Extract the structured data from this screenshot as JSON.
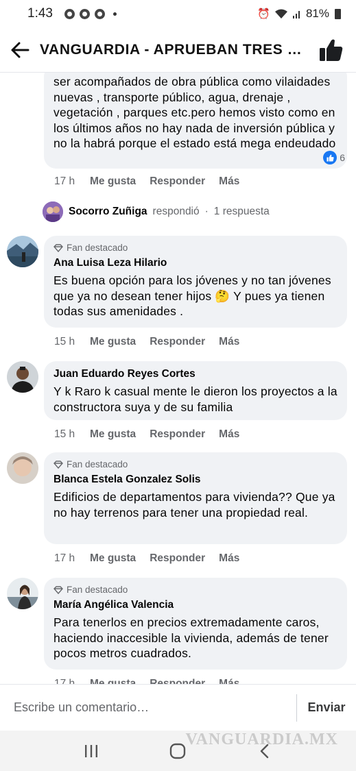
{
  "status_bar": {
    "time": "1:43",
    "battery": "81%"
  },
  "header": {
    "title": "VANGUARDIA - APRUEBAN TRES DE..."
  },
  "comments": [
    {
      "text": "ser acompañados de obra pública como vilaidades nuevas , transporte público, agua, drenaje , vegetación , parques etc.pero hemos visto como en los últimos años no hay nada de inversión pública y no la habrá porque el estado está mega endeudado",
      "reaction_count": "6",
      "time": "17 h",
      "like": "Me gusta",
      "reply": "Responder",
      "more": "Más"
    },
    {
      "badge": "Fan destacado",
      "author": "Ana Luisa Leza Hilario",
      "text": "Es buena opción para los jóvenes y no tan jóvenes que ya no desean tener hijos 🤔 Y pues ya tienen todas sus amenidades .",
      "time": "15 h",
      "like": "Me gusta",
      "reply": "Responder",
      "more": "Más"
    },
    {
      "author": "Juan Eduardo Reyes Cortes",
      "text": "Y k Raro k casual mente le dieron los proyectos a la constructora suya y de su familia",
      "time": "15 h",
      "like": "Me gusta",
      "reply": "Responder",
      "more": "Más"
    },
    {
      "badge": "Fan destacado",
      "author": "Blanca Estela Gonzalez Solis",
      "text": "Edificios de departamentos para vivienda?? Que ya no hay terrenos para tener una propiedad real.",
      "time": "17 h",
      "like": "Me gusta",
      "reply": "Responder",
      "more": "Más"
    },
    {
      "badge": "Fan destacado",
      "author": "María Angélica Valencia",
      "text": "Para tenerlos en precios extremadamente caros, haciendo inaccesible la vivienda, además de tener pocos metros cuadrados.",
      "time": "17 h",
      "like": "Me gusta",
      "reply": "Responder",
      "more": "Más"
    }
  ],
  "reply_summary": {
    "author": "Socorro Zuñiga",
    "verb": "respondió",
    "separator": "·",
    "count": "1 respuesta"
  },
  "composer": {
    "placeholder": "Escribe un comentario…",
    "send_label": "Enviar"
  },
  "watermark": "VANGUARDIA.MX"
}
